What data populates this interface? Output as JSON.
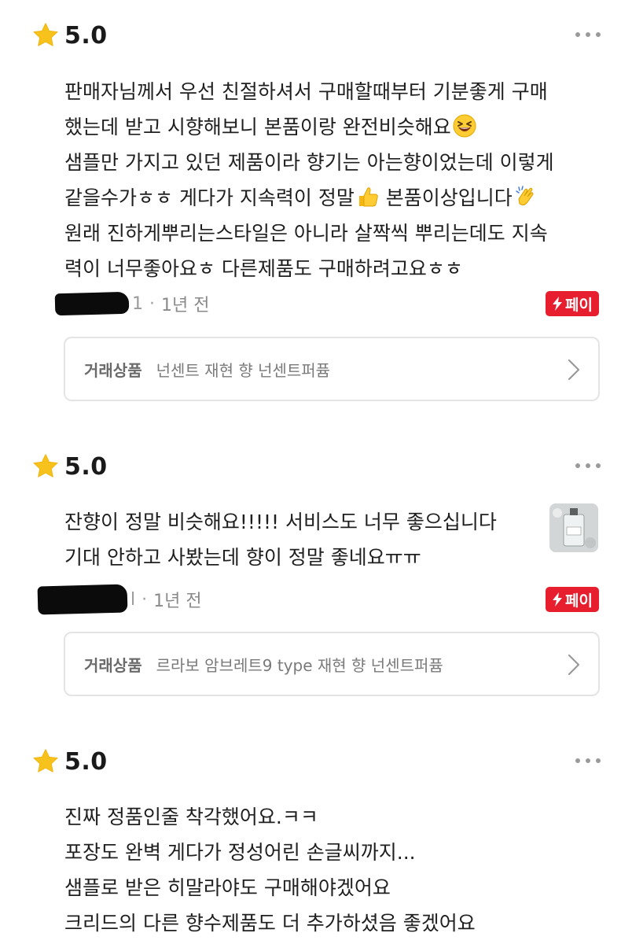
{
  "reviews": [
    {
      "score": "5.0",
      "lines": [
        "판매자님께서 우선 친절하셔서 구매할때부터 기분좋게 구매",
        "했는데 받고 시향해보니 본품이랑 완전비슷해요",
        "샘플만 가지고 있던 제품이라 향기는 아는향이었는데 이렇게",
        "같을수가ㅎㅎ 게다가 지속력이 정말",
        "원래 진하게뿌리는스타일은 아니라 살짝씩 뿌리는데도 지속",
        "력이 너무좋아요ㅎ 다른제품도 구매하려고요ㅎㅎ"
      ],
      "line4_tail": "본품이상입니다",
      "time": "1년 전",
      "user_suffix": "1",
      "pay_badge": "페이",
      "product_label": "거래상품",
      "product_name": "넌센트 재현 향 넌센트퍼퓸"
    },
    {
      "score": "5.0",
      "lines": [
        "잔향이 정말 비슷해요!!!!! 서비스도 너무 좋으십니다",
        "기대 안하고 사봤는데 향이 정말 좋네요ㅠㅠ"
      ],
      "time": "1년 전",
      "user_suffix": "l",
      "pay_badge": "페이",
      "product_label": "거래상품",
      "product_name": "르라보 암브레트9 type 재현 향 넌센트퍼퓸"
    },
    {
      "score": "5.0",
      "lines": [
        "진짜 정품인줄 착각했어요.ㅋㅋ",
        "포장도 완벽 게다가 정성어린 손글씨까지...",
        "샘플로 받은 히말라야도 구매해야겠어요",
        "크리드의 다른 향수제품도 더 추가하셨음 좋겠어요"
      ]
    }
  ],
  "icons": {
    "star": "star-icon",
    "more": "more-options-icon",
    "bolt": "lightning-icon",
    "chevron": "chevron-right-icon",
    "emoji_laugh": "grinning-squinting-face-icon",
    "emoji_thumbs": "thumbs-up-icon",
    "emoji_clap": "clapping-hands-icon"
  },
  "colors": {
    "star": "#F7C21B",
    "pay_badge": "#E61E2D",
    "card_border": "#E4E4E4"
  }
}
